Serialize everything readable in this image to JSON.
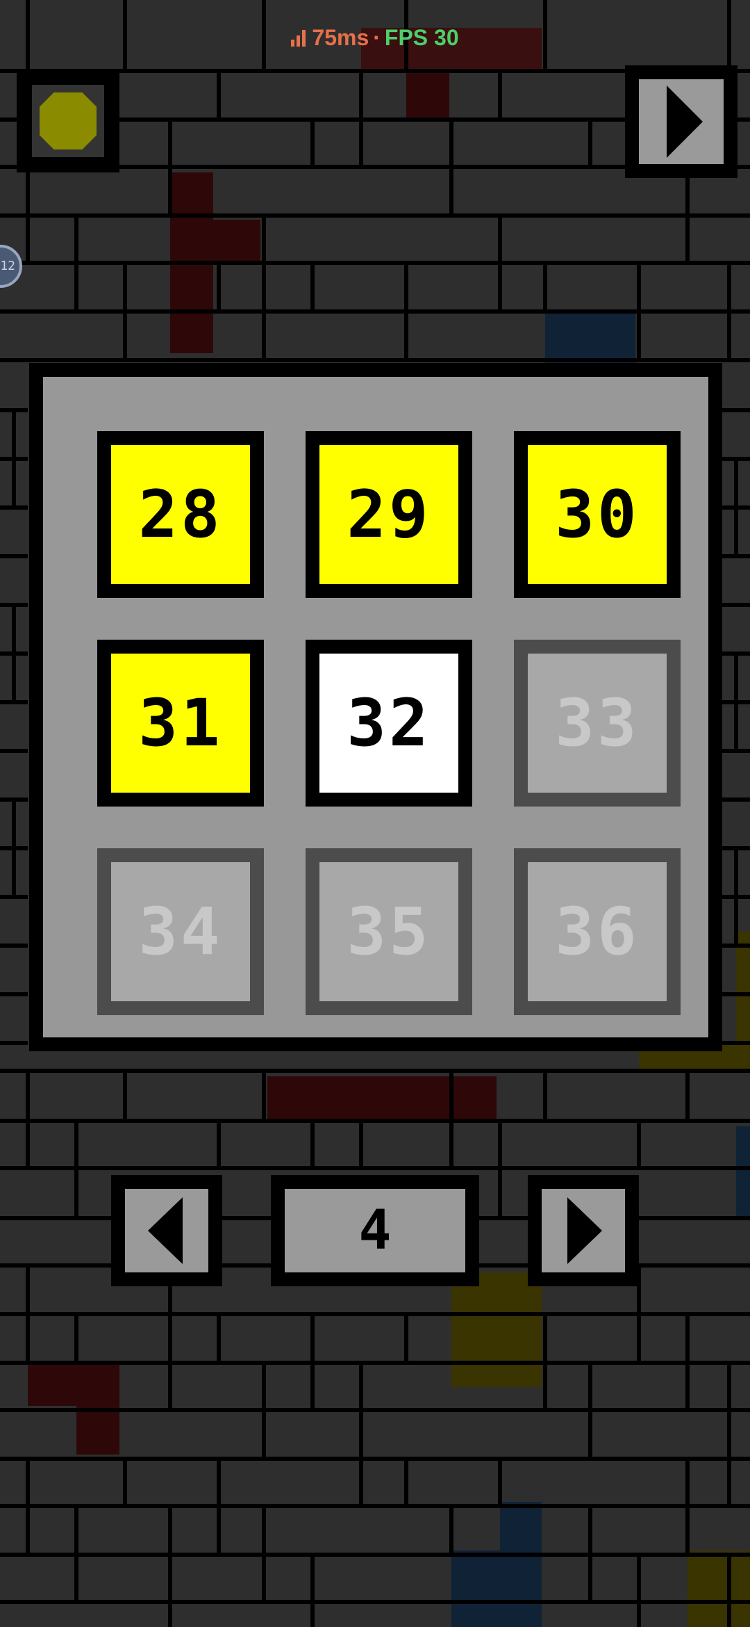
{
  "status": {
    "ping": "75ms",
    "separator": "·",
    "fps": "FPS 30"
  },
  "side_badge": {
    "text": "12"
  },
  "level_select": {
    "levels": [
      {
        "number": "28",
        "state": "completed"
      },
      {
        "number": "29",
        "state": "completed"
      },
      {
        "number": "30",
        "state": "completed"
      },
      {
        "number": "31",
        "state": "completed"
      },
      {
        "number": "32",
        "state": "current"
      },
      {
        "number": "33",
        "state": "locked"
      },
      {
        "number": "34",
        "state": "locked"
      },
      {
        "number": "35",
        "state": "locked"
      },
      {
        "number": "36",
        "state": "locked"
      }
    ]
  },
  "pager": {
    "page": "4"
  },
  "icons": {
    "coin": "coin-icon",
    "play": "play-icon",
    "prev": "arrow-left-icon",
    "next": "arrow-right-icon",
    "signal": "signal-icon"
  },
  "colors": {
    "completed": "#ffff00",
    "current": "#ffffff",
    "locked": "#a8a8a8",
    "ping": "#e8704a",
    "fps": "#4bd06a"
  }
}
